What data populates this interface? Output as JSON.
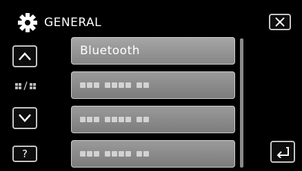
{
  "header": {
    "title": "GENERAL",
    "icon": "gear-icon"
  },
  "buttons": {
    "close_icon": "close-icon",
    "up_icon": "chevron-up-icon",
    "down_icon": "chevron-down-icon",
    "help_label": "?",
    "back_icon": "return-arrow-icon"
  },
  "menu": {
    "items": [
      {
        "label": "Bluetooth"
      },
      {
        "label": ""
      },
      {
        "label": ""
      },
      {
        "label": ""
      }
    ]
  }
}
